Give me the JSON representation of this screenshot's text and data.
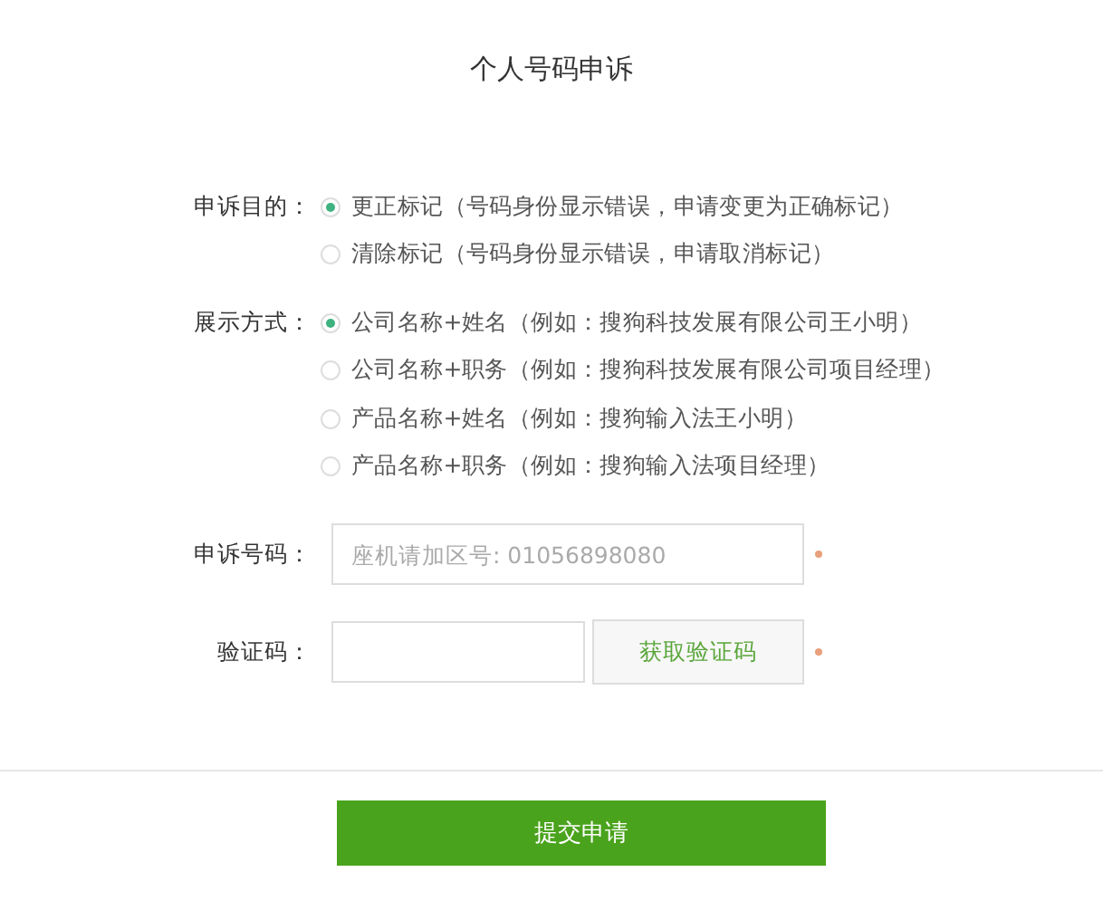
{
  "title": "个人号码申诉",
  "groups": [
    {
      "label": "申诉目的：",
      "options": [
        {
          "label": "更正标记（号码身份显示错误，申请变更为正确标记）",
          "selected": true
        },
        {
          "label": "清除标记（号码身份显示错误，申请取消标记）",
          "selected": false
        }
      ]
    },
    {
      "label": "展示方式：",
      "options": [
        {
          "label": "公司名称+姓名（例如：搜狗科技发展有限公司王小明）",
          "selected": true
        },
        {
          "label": "公司名称+职务（例如：搜狗科技发展有限公司项目经理）",
          "selected": false
        },
        {
          "label": "产品名称+姓名（例如：搜狗输入法王小明）",
          "selected": false
        },
        {
          "label": "产品名称+职务（例如：搜狗输入法项目经理）",
          "selected": false
        }
      ]
    }
  ],
  "phone": {
    "label": "申诉号码：",
    "placeholder": "座机请加区号: 01056898080",
    "required": true
  },
  "code": {
    "label": "验证码：",
    "button": "获取验证码",
    "required": true
  },
  "submit": "提交申请"
}
